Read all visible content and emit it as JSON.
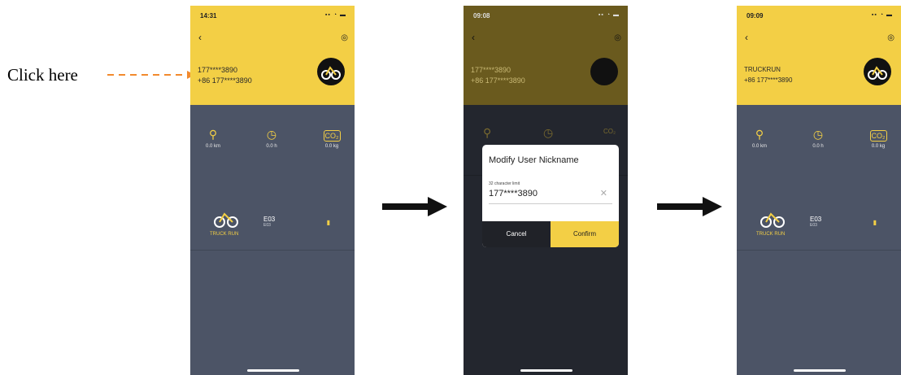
{
  "annotation": {
    "text": "Click here"
  },
  "arrow_color": "#f28a2e",
  "phones": [
    {
      "status_time": "14:31",
      "name_line1": "177****3890",
      "name_line2": "+86 177****3890",
      "stats": [
        {
          "label": "0.0 km"
        },
        {
          "label": "0.0 h"
        },
        {
          "label": "0.0 kg"
        }
      ],
      "device": {
        "name": "E03",
        "sub": "E03",
        "brand": "TRUCK RUN"
      }
    },
    {
      "status_time": "09:08",
      "name_line1": "177****3890",
      "name_line2": "+86 177****3890",
      "dialog": {
        "title": "Modify User Nickname",
        "hint": "32 character limit",
        "value": "177****3890",
        "cancel": "Cancel",
        "confirm": "Confirm"
      }
    },
    {
      "status_time": "09:09",
      "name_line1": "TRUCKRUN",
      "name_line2": "+86 177****3890",
      "stats": [
        {
          "label": "0.0 km"
        },
        {
          "label": "0.0 h"
        },
        {
          "label": "0.0 kg"
        }
      ],
      "device": {
        "name": "E03",
        "sub": "E03",
        "brand": "TRUCK RUN"
      }
    }
  ]
}
